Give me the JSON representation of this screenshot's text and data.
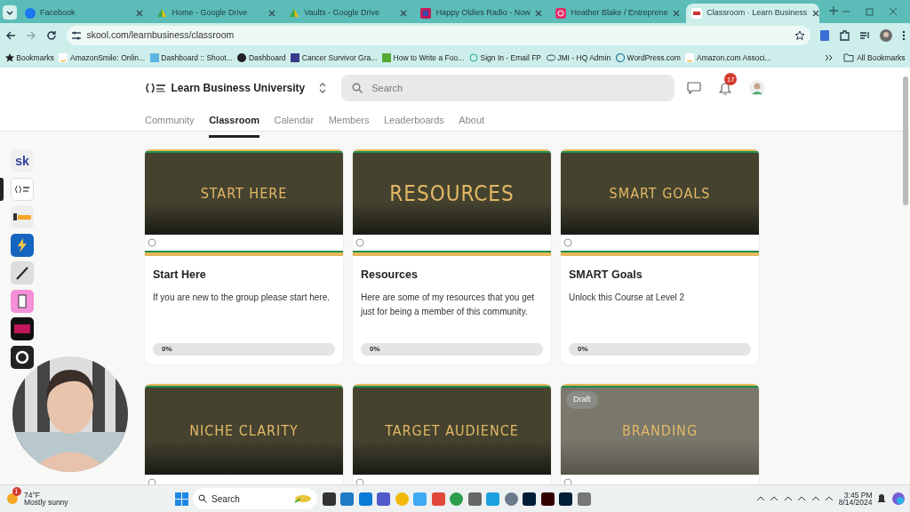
{
  "browser": {
    "tabs": [
      {
        "title": "Facebook",
        "selected": false
      },
      {
        "title": "Home - Google Drive",
        "selected": false
      },
      {
        "title": "Vaults - Google Drive",
        "selected": false
      },
      {
        "title": "Happy Oldies Radio - Now",
        "selected": false
      },
      {
        "title": "Heather Blake / Entreprene",
        "selected": false
      },
      {
        "title": "Classroom · Learn Business",
        "selected": true
      }
    ],
    "address": "skool.com/learnbusiness/classroom",
    "bookmarks": [
      "Bookmarks",
      "AmazonSmile: Onlin...",
      "Dashboard :: Shoot...",
      "Dashboard",
      "Cancer Survivor Gra...",
      "How to Write a Foo...",
      "Sign In - Email FP",
      "JMI - HQ Admin",
      "WordPress.com",
      "Amazon.com Associ..."
    ],
    "all_bookmarks": "All Bookmarks"
  },
  "app": {
    "sidebar_logo": "sk",
    "sidebar": [
      {
        "selected": false
      },
      {
        "selected": true
      },
      {
        "selected": false
      },
      {
        "selected": false
      },
      {
        "selected": false
      },
      {
        "selected": false
      },
      {
        "selected": false
      },
      {
        "selected": false
      }
    ],
    "community_name": "Learn Business University",
    "search": {
      "placeholder": "Search"
    },
    "notification_count": "17",
    "nav": [
      {
        "label": "Community",
        "selected": false
      },
      {
        "label": "Classroom",
        "selected": true
      },
      {
        "label": "Calendar",
        "selected": false
      },
      {
        "label": "Members",
        "selected": false
      },
      {
        "label": "Leaderboards",
        "selected": false
      },
      {
        "label": "About",
        "selected": false
      }
    ],
    "courses": [
      {
        "cover_title": "START HERE",
        "title": "Start Here",
        "description": "If you are new to the group please start here.",
        "progress": "0%",
        "level": 0,
        "draft": false
      },
      {
        "cover_title": "RESOURCES",
        "title": "Resources",
        "description": "Here are some of my resources that you get just for being a member of this community.",
        "progress": "0%",
        "level": 0,
        "draft": false
      },
      {
        "cover_title": "SMART GOALS",
        "title": "SMART Goals",
        "description": "Unlock this Course at Level 2",
        "progress": "0%",
        "level": 0,
        "draft": false
      },
      {
        "cover_title": "NICHE CLARITY",
        "draft": false
      },
      {
        "cover_title": "TARGET AUDIENCE",
        "draft": false
      },
      {
        "cover_title": "BRANDING",
        "draft": true,
        "draft_label": "Draft"
      }
    ]
  },
  "taskbar": {
    "weather_badge": "1",
    "temperature": "74°F",
    "condition": "Mostly sunny",
    "search": "Search",
    "time": "3:45 PM",
    "date": "8/14/2024"
  }
}
